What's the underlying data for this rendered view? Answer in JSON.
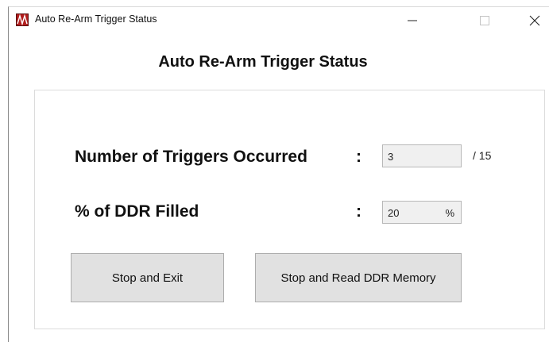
{
  "window": {
    "title": "Auto Re-Arm Trigger Status"
  },
  "main": {
    "heading": "Auto Re-Arm Trigger Status",
    "rows": [
      {
        "label": "Number of Triggers Occurred",
        "colon": ":",
        "value": "3",
        "suffix": "/ 15"
      },
      {
        "label": "% of DDR Filled",
        "colon": ":",
        "value": "20",
        "unit": "%"
      }
    ],
    "buttons": {
      "stop_exit": "Stop and Exit",
      "stop_read": "Stop and Read DDR Memory"
    }
  },
  "icons": {
    "app": "app-icon",
    "minimize": "minimize-icon",
    "maximize": "maximize-icon",
    "close": "close-icon"
  }
}
